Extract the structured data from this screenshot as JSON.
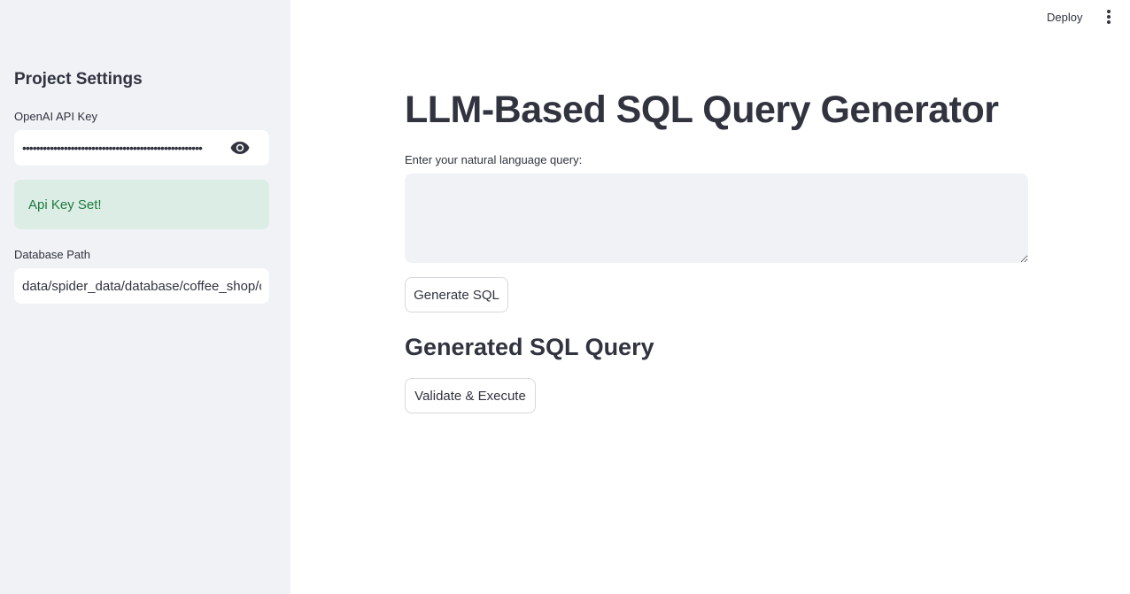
{
  "sidebar": {
    "title": "Project Settings",
    "api_key": {
      "label": "OpenAI API Key",
      "masked_value": "••••••••••••••••••••••••••••••••••••••••••••••••••••"
    },
    "success_message": "Api Key Set!",
    "database_path": {
      "label": "Database Path",
      "value": "data/spider_data/database/coffee_shop/coffee_shop.sqlite"
    }
  },
  "header": {
    "deploy_label": "Deploy",
    "menu_icon": "kebab-menu-icon"
  },
  "main": {
    "title": "LLM-Based SQL Query Generator",
    "query_label": "Enter your natural language query:",
    "query_value": "",
    "generate_button": "Generate SQL",
    "generated_heading": "Generated SQL Query",
    "validate_button": "Validate & Execute"
  },
  "colors": {
    "sidebar_bg": "#f0f2f6",
    "text": "#31333f",
    "success_bg": "#dcede6",
    "success_text": "#1c7a3d"
  }
}
